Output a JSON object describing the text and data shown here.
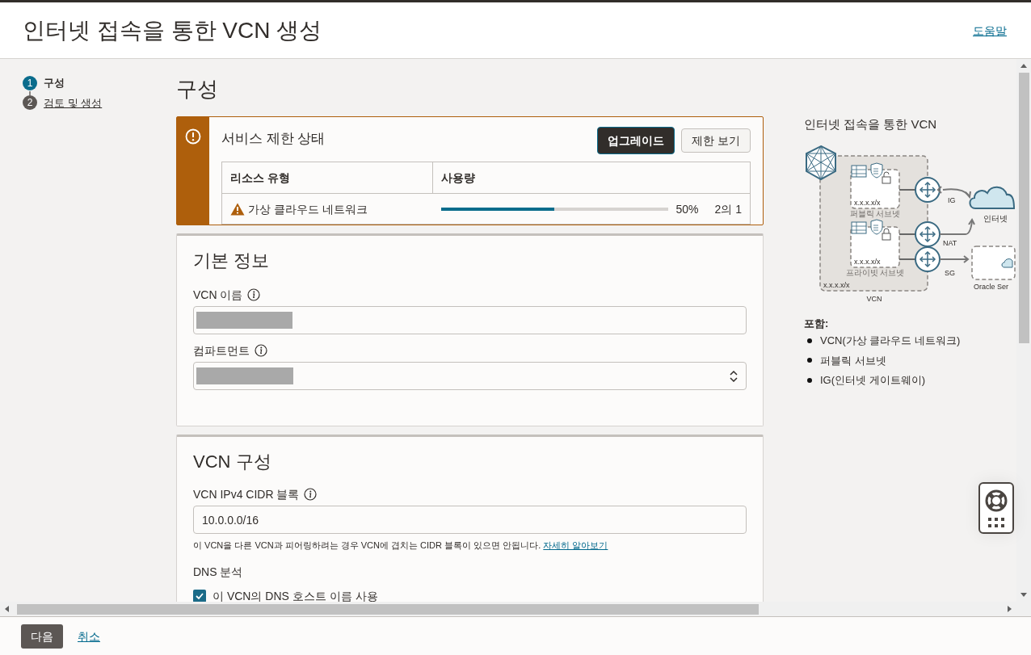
{
  "page": {
    "title": "인터넷 접속을 통한 VCN 생성",
    "help_link": "도움말"
  },
  "steps": [
    {
      "number": "1",
      "label": "구성",
      "selected": true
    },
    {
      "number": "2",
      "label": "검토 및 생성",
      "selected": false
    }
  ],
  "section_title": "구성",
  "limit_alert": {
    "title": "서비스 제한 상태",
    "buttons": [
      {
        "label": "업그레이드",
        "kind": "primary"
      },
      {
        "label": "제한 보기",
        "kind": "secondary"
      }
    ],
    "columns": [
      "리소스 유형",
      "사용량"
    ],
    "rows": [
      {
        "resource": "가상 클라우드 네트워크",
        "level": 0.5,
        "percent": "50%",
        "count": "2의 1"
      }
    ]
  },
  "basic_info": {
    "title": "기본 정보",
    "fields": [
      {
        "label": "VCN 이름",
        "kind": "text"
      },
      {
        "label": "컴파트먼트",
        "kind": "select"
      }
    ]
  },
  "vcn_config": {
    "title": "VCN 구성",
    "cidr_label": "VCN IPv4 CIDR 블록",
    "cidr_value": "10.0.0.0/16",
    "help_text": "이 VCN을 다른 VCN과 피어링하려는 경우 VCN에 겹치는 CIDR 블록이 있으면 안됩니다.",
    "help_link": "자세히 알아보기",
    "dns_title": "DNS 분석",
    "dns_checkbox": {
      "label": "이 VCN의 DNS 호스트 이름 사용",
      "checked": true
    }
  },
  "preview": {
    "title": "인터넷 접속을 통한 VCN",
    "diagram_labels": {
      "public_cidr": "x.x.x.x/x",
      "public_subnet": "퍼블릭 서브넷",
      "private_cidr": "x.x.x.x/x",
      "private_subnet": "프라이빗 서브넷",
      "vcn_cidr": "x.x.x.x/x",
      "vcn": "VCN",
      "ig": "IG",
      "nat": "NAT",
      "sg": "SG",
      "internet": "인터넷",
      "oracle": "Oracle Ser"
    },
    "includes_title": "포함:",
    "includes": [
      "VCN(가상 클라우드 네트워크)",
      "퍼블릭 서브넷",
      "IG(인터넷 게이트웨이)"
    ]
  },
  "footer": {
    "next": "다음",
    "cancel": "취소"
  }
}
